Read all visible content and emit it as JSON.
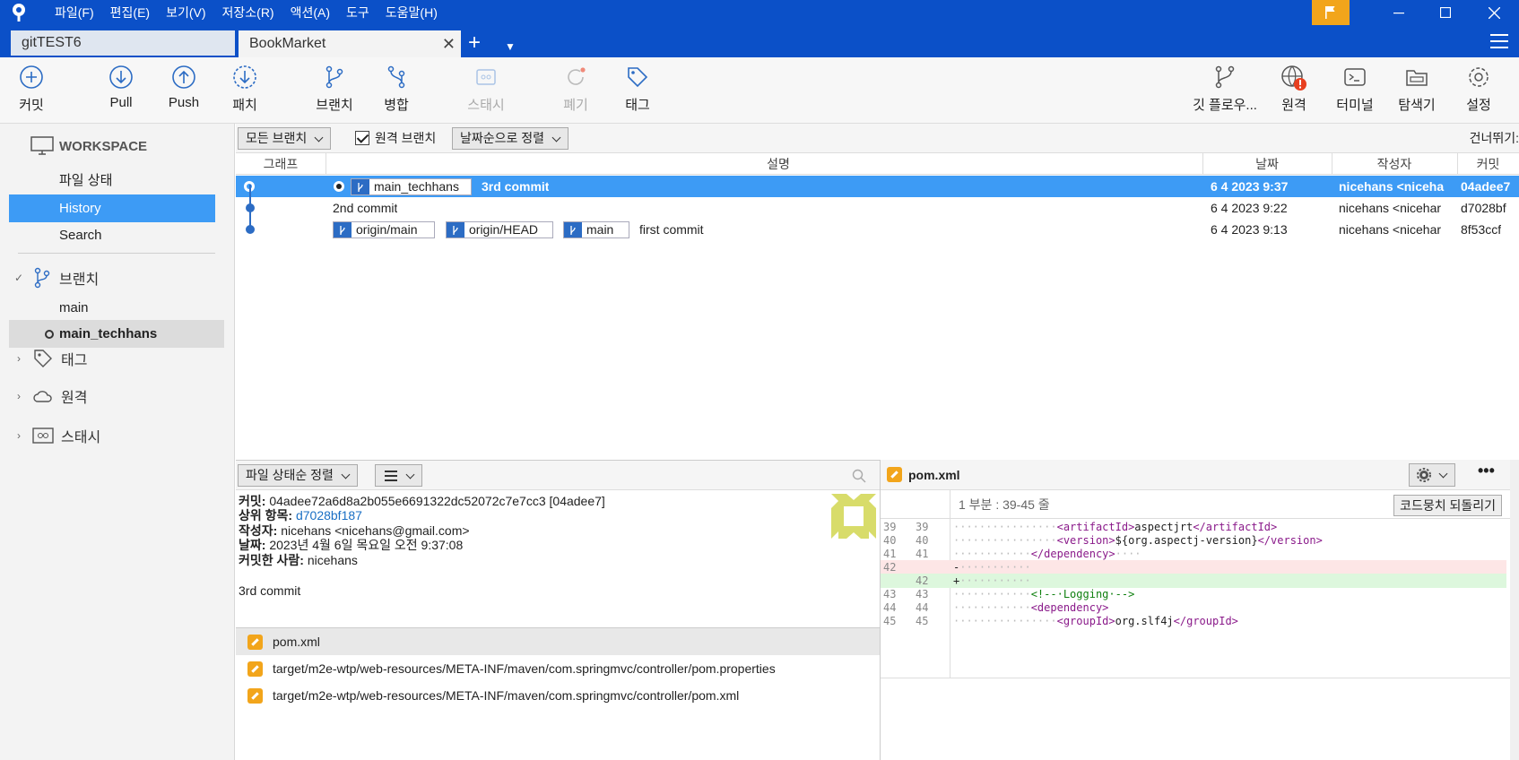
{
  "menu": [
    "파일(F)",
    "편집(E)",
    "보기(V)",
    "저장소(R)",
    "액션(A)",
    "도구",
    "도움말(H)"
  ],
  "tabs": {
    "inactive": "gitTEST6",
    "active": "BookMarket"
  },
  "toolbar": {
    "commit": "커밋",
    "pull": "Pull",
    "push": "Push",
    "patch": "패치",
    "branch": "브랜치",
    "merge": "병합",
    "stash": "스태시",
    "discard": "폐기",
    "tag": "태그",
    "gitflow": "깃 플로우...",
    "remote": "원격",
    "terminal": "터미널",
    "explorer": "탐색기",
    "settings": "설정"
  },
  "sidebar": {
    "workspace": "WORKSPACE",
    "file_status": "파일 상태",
    "history": "History",
    "search": "Search",
    "branches_label": "브랜치",
    "branches": [
      "main",
      "main_techhans"
    ],
    "tags_label": "태그",
    "remotes_label": "원격",
    "stashes_label": "스태시"
  },
  "filters": {
    "branch_filter": "모든 브랜치",
    "remote_branches": "원격 브랜치",
    "sort": "날짜순으로 정렬",
    "skip": "건너뛰기:"
  },
  "history": {
    "columns": {
      "graph": "그래프",
      "desc": "설명",
      "date": "날짜",
      "author": "작성자",
      "commit": "커밋"
    },
    "rows": [
      {
        "branch": "main_techhans",
        "desc": "3rd commit",
        "date": "6 4 2023 9:37",
        "author": "nicehans <niceha",
        "hash": "04adee7"
      },
      {
        "desc": "2nd commit",
        "date": "6 4 2023 9:22",
        "author": "nicehans <nicehar",
        "hash": "d7028bf"
      },
      {
        "tags": [
          "origin/main",
          "origin/HEAD",
          "main"
        ],
        "desc": "first commit",
        "date": "6 4 2023 9:13",
        "author": "nicehans <nicehar",
        "hash": "8f53ccf"
      }
    ]
  },
  "lower": {
    "sort": "파일 상태순 정렬",
    "commit_label": "커밋:",
    "commit_value": "04adee72a6d8a2b055e6691322dc52072c7e7cc3 [04adee7]",
    "parent_label": "상위 항목:",
    "parent_value": "d7028bf187",
    "author_label": "작성자:",
    "author_value": "nicehans <nicehans@gmail.com>",
    "date_label": "날짜:",
    "date_value": "2023년 4월 6일 목요일 오전 9:37:08",
    "committer_label": "커밋한 사람:",
    "committer_value": "nicehans",
    "message": "3rd commit",
    "files": [
      "pom.xml",
      "target/m2e-wtp/web-resources/META-INF/maven/com.springmvc/controller/pom.properties",
      "target/m2e-wtp/web-resources/META-INF/maven/com.springmvc/controller/pom.xml"
    ]
  },
  "diff": {
    "file": "pom.xml",
    "hunk": "1 부분 : 39-45 줄",
    "revert": "코드뭉치 되돌리기",
    "lines": [
      {
        "l1": "39",
        "l2": "39",
        "type": "ctx",
        "indent": 16,
        "open": "<artifactId>",
        "text": "aspectjrt",
        "close": "</artifactId>"
      },
      {
        "l1": "40",
        "l2": "40",
        "type": "ctx",
        "indent": 16,
        "open": "<version>",
        "text": "${org.aspectj-version}",
        "close": "</version>"
      },
      {
        "l1": "41",
        "l2": "41",
        "type": "ctx",
        "indent": 12,
        "open": "</dependency>",
        "text": "",
        "close": "",
        "trail": "····"
      },
      {
        "l1": "42",
        "l2": "",
        "type": "del",
        "text": "-···········"
      },
      {
        "l1": "",
        "l2": "42",
        "type": "add",
        "text": "+···········"
      },
      {
        "l1": "43",
        "l2": "43",
        "type": "cmt",
        "indent": 12,
        "text": "<!--·Logging·-->"
      },
      {
        "l1": "44",
        "l2": "44",
        "type": "ctx",
        "indent": 12,
        "open": "<dependency>",
        "text": "",
        "close": ""
      },
      {
        "l1": "45",
        "l2": "45",
        "type": "ctx",
        "indent": 16,
        "open": "<groupId>",
        "text": "org.slf4j",
        "close": "</groupId>"
      }
    ]
  },
  "colors": {
    "brand": "#0b50c8",
    "selection": "#3d9bf5",
    "flag": "#f2a51b"
  }
}
